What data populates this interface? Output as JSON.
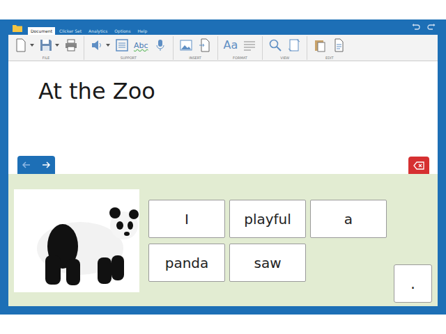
{
  "menu_tabs": [
    {
      "label": "Document",
      "selected": true
    },
    {
      "label": "Clicker Set",
      "selected": false
    },
    {
      "label": "Analytics",
      "selected": false
    },
    {
      "label": "Options",
      "selected": false
    },
    {
      "label": "Help",
      "selected": false
    }
  ],
  "ribbon": {
    "groups": [
      {
        "label": "FILE"
      },
      {
        "label": "SUPPORT"
      },
      {
        "label": "INSERT"
      },
      {
        "label": "FORMAT"
      },
      {
        "label": "VIEW"
      },
      {
        "label": "EDIT"
      }
    ],
    "spell_glyph": "Abc",
    "font_glyph": "Aa"
  },
  "document": {
    "title": "At the Zoo"
  },
  "word_bank": {
    "words": [
      {
        "text": "I"
      },
      {
        "text": "playful"
      },
      {
        "text": "a"
      },
      {
        "text": "panda"
      },
      {
        "text": "saw"
      }
    ],
    "punctuation": "."
  }
}
